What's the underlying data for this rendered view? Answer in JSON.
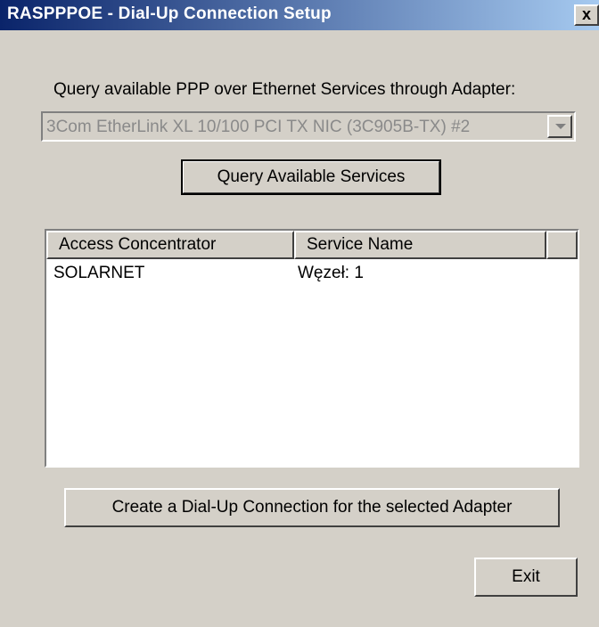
{
  "window": {
    "title": "RASPPPOE - Dial-Up Connection Setup",
    "close_label": "x"
  },
  "adapter_section": {
    "label": "Query available PPP over Ethernet Services through Adapter:",
    "selected_adapter": "3Com EtherLink XL 10/100 PCI TX NIC (3C905B-TX) #2",
    "query_button": "Query Available Services"
  },
  "services_list": {
    "columns": [
      "Access Concentrator",
      "Service Name",
      ""
    ],
    "rows": [
      {
        "access_concentrator": "SOLARNET",
        "service_name": "Węzeł: 1"
      }
    ]
  },
  "actions": {
    "create_button": "Create a Dial-Up Connection for the selected Adapter",
    "exit_button": "Exit"
  }
}
